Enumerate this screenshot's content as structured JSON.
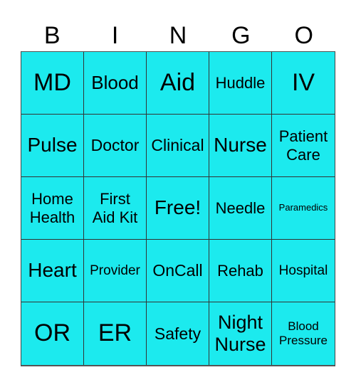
{
  "header": {
    "letters": [
      "B",
      "I",
      "N",
      "G",
      "O"
    ]
  },
  "colors": {
    "cell_background": "#1ceaee",
    "border": "#333333",
    "text": "#000000"
  },
  "board": {
    "cells": [
      {
        "text": "MD",
        "size": "xl"
      },
      {
        "text": "Blood",
        "size": "l"
      },
      {
        "text": "Aid",
        "size": "xl"
      },
      {
        "text": "Huddle",
        "size": "m"
      },
      {
        "text": "IV",
        "size": "xl"
      },
      {
        "text": "Pulse",
        "size": "l"
      },
      {
        "text": "Doctor",
        "size": "m"
      },
      {
        "text": "Clinical",
        "size": "m"
      },
      {
        "text": "Nurse",
        "size": "l"
      },
      {
        "text": "Patient\nCare",
        "size": "m"
      },
      {
        "text": "Home\nHealth",
        "size": "m"
      },
      {
        "text": "First\nAid Kit",
        "size": "m"
      },
      {
        "text": "Free!",
        "size": "l"
      },
      {
        "text": "Needle",
        "size": "m"
      },
      {
        "text": "Paramedics",
        "size": "xs"
      },
      {
        "text": "Heart",
        "size": "l"
      },
      {
        "text": "Provider",
        "size": "s"
      },
      {
        "text": "OnCall",
        "size": "m"
      },
      {
        "text": "Rehab",
        "size": "m"
      },
      {
        "text": "Hospital",
        "size": "s"
      },
      {
        "text": "OR",
        "size": "xl"
      },
      {
        "text": "ER",
        "size": "xl"
      },
      {
        "text": "Safety",
        "size": "m"
      },
      {
        "text": "Night\nNurse",
        "size": "l"
      },
      {
        "text": "Blood\nPressure",
        "size": "s"
      }
    ]
  }
}
